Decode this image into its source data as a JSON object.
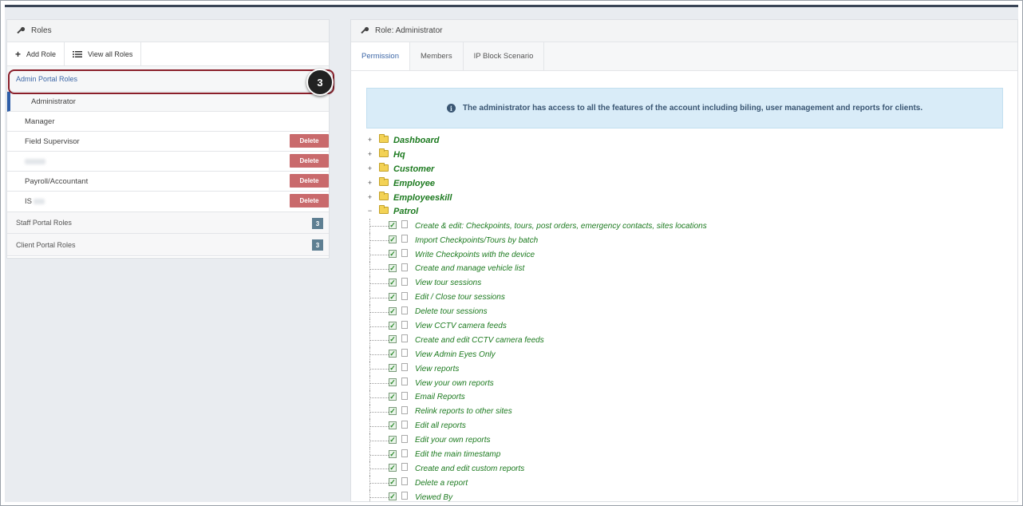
{
  "left_panel": {
    "title": "Roles",
    "toolbar": {
      "add_role": "Add Role",
      "view_all": "View all Roles"
    },
    "admin_group": "Admin Portal Roles",
    "roles": [
      {
        "name": "Administrator",
        "delete": ""
      },
      {
        "name": "Manager",
        "delete": ""
      },
      {
        "name": "Field Supervisor",
        "delete": "Delete"
      },
      {
        "name": "",
        "delete": "Delete"
      },
      {
        "name": "Payroll/Accountant",
        "delete": "Delete"
      },
      {
        "name": "IS",
        "delete": "Delete"
      }
    ],
    "staff_group": {
      "label": "Staff Portal Roles",
      "count": "3"
    },
    "client_group": {
      "label": "Client Portal Roles",
      "count": "3"
    },
    "step_number": "3"
  },
  "right_panel": {
    "title": "Role: Administrator",
    "tabs": [
      "Permission",
      "Members",
      "IP Block Scenario"
    ],
    "notice": "The administrator has access to all the features of the account including biling, user management and reports for clients.",
    "folders": [
      "Dashboard",
      "Hq",
      "Customer",
      "Employee",
      "Employeeskill",
      "Patrol"
    ],
    "patrol_permissions": [
      "Create & edit: Checkpoints, tours, post orders, emergency contacts, sites locations",
      "Import Checkpoints/Tours by batch",
      "Write Checkpoints with the device",
      "Create and manage vehicle list",
      "View tour sessions",
      "Edit / Close tour sessions",
      "Delete tour sessions",
      "View CCTV camera feeds",
      "Create and edit CCTV camera feeds",
      "View Admin Eyes Only",
      "View reports",
      "View your own reports",
      "Email Reports",
      "Relink reports to other sites",
      "Edit all reports",
      "Edit your own reports",
      "Edit the main timestamp",
      "Create and edit custom reports",
      "Delete a report",
      "Viewed By"
    ]
  },
  "colors": {
    "accent": "#3d67a7",
    "permission_text": "#1c7a1f",
    "delete_btn": "#c96a6c",
    "highlight": "#8a1f2a"
  }
}
